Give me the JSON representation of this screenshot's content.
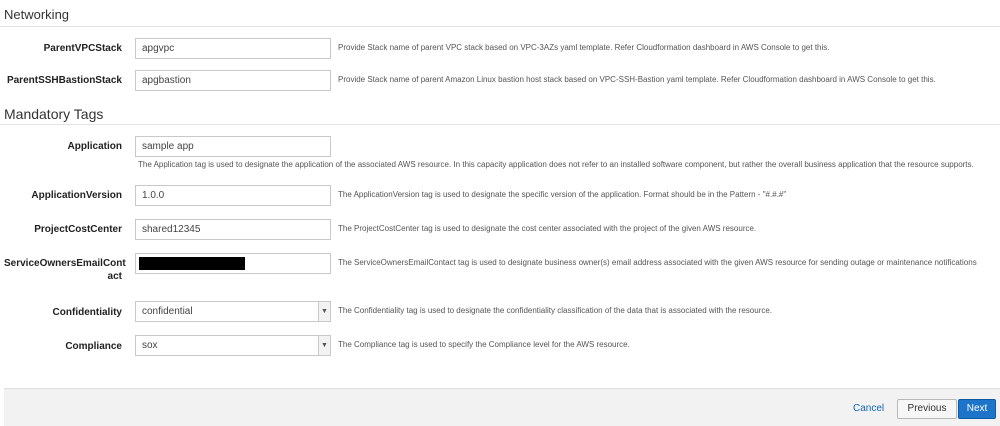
{
  "networking": {
    "title": "Networking",
    "params": [
      {
        "label": "ParentVPCStack",
        "value": "apgvpc",
        "help": "Provide Stack name of parent VPC stack based on VPC-3AZs yaml template. Refer Cloudformation dashboard in AWS Console to get this."
      },
      {
        "label": "ParentSSHBastionStack",
        "value": "apgbastion",
        "help": "Provide Stack name of parent Amazon Linux bastion host stack based on VPC-SSH-Bastion yaml template. Refer Cloudformation dashboard in AWS Console to get this."
      }
    ]
  },
  "tags": {
    "title": "Mandatory Tags",
    "params": [
      {
        "label": "Application",
        "value": "sample app",
        "help": "The Application tag is used to designate the application of the associated AWS resource. In this capacity application does not refer to an installed software component, but rather the overall business application that the resource supports."
      },
      {
        "label": "ApplicationVersion",
        "value": "1.0.0",
        "help": "The ApplicationVersion tag is used to designate the specific version of the application. Format should be in the Pattern - \"#.#.#\""
      },
      {
        "label": "ProjectCostCenter",
        "value": "shared12345",
        "help": "The ProjectCostCenter tag is used to designate the cost center associated with the project of the given AWS resource."
      },
      {
        "label_line1": "ServiceOwnersEmailCont",
        "label_line2": "act",
        "value": "",
        "help": "The ServiceOwnersEmailContact tag is used to designate business owner(s) email address associated with the given AWS resource for sending outage or maintenance notifications"
      },
      {
        "label": "Confidentiality",
        "value": "confidential",
        "help": "The Confidentiality tag is used to designate the confidentiality classification of the data that is associated with the resource."
      },
      {
        "label": "Compliance",
        "value": "sox",
        "help": "The Compliance tag is used to specify the Compliance level for the AWS resource."
      }
    ]
  },
  "footer": {
    "cancel": "Cancel",
    "previous": "Previous",
    "next": "Next"
  }
}
